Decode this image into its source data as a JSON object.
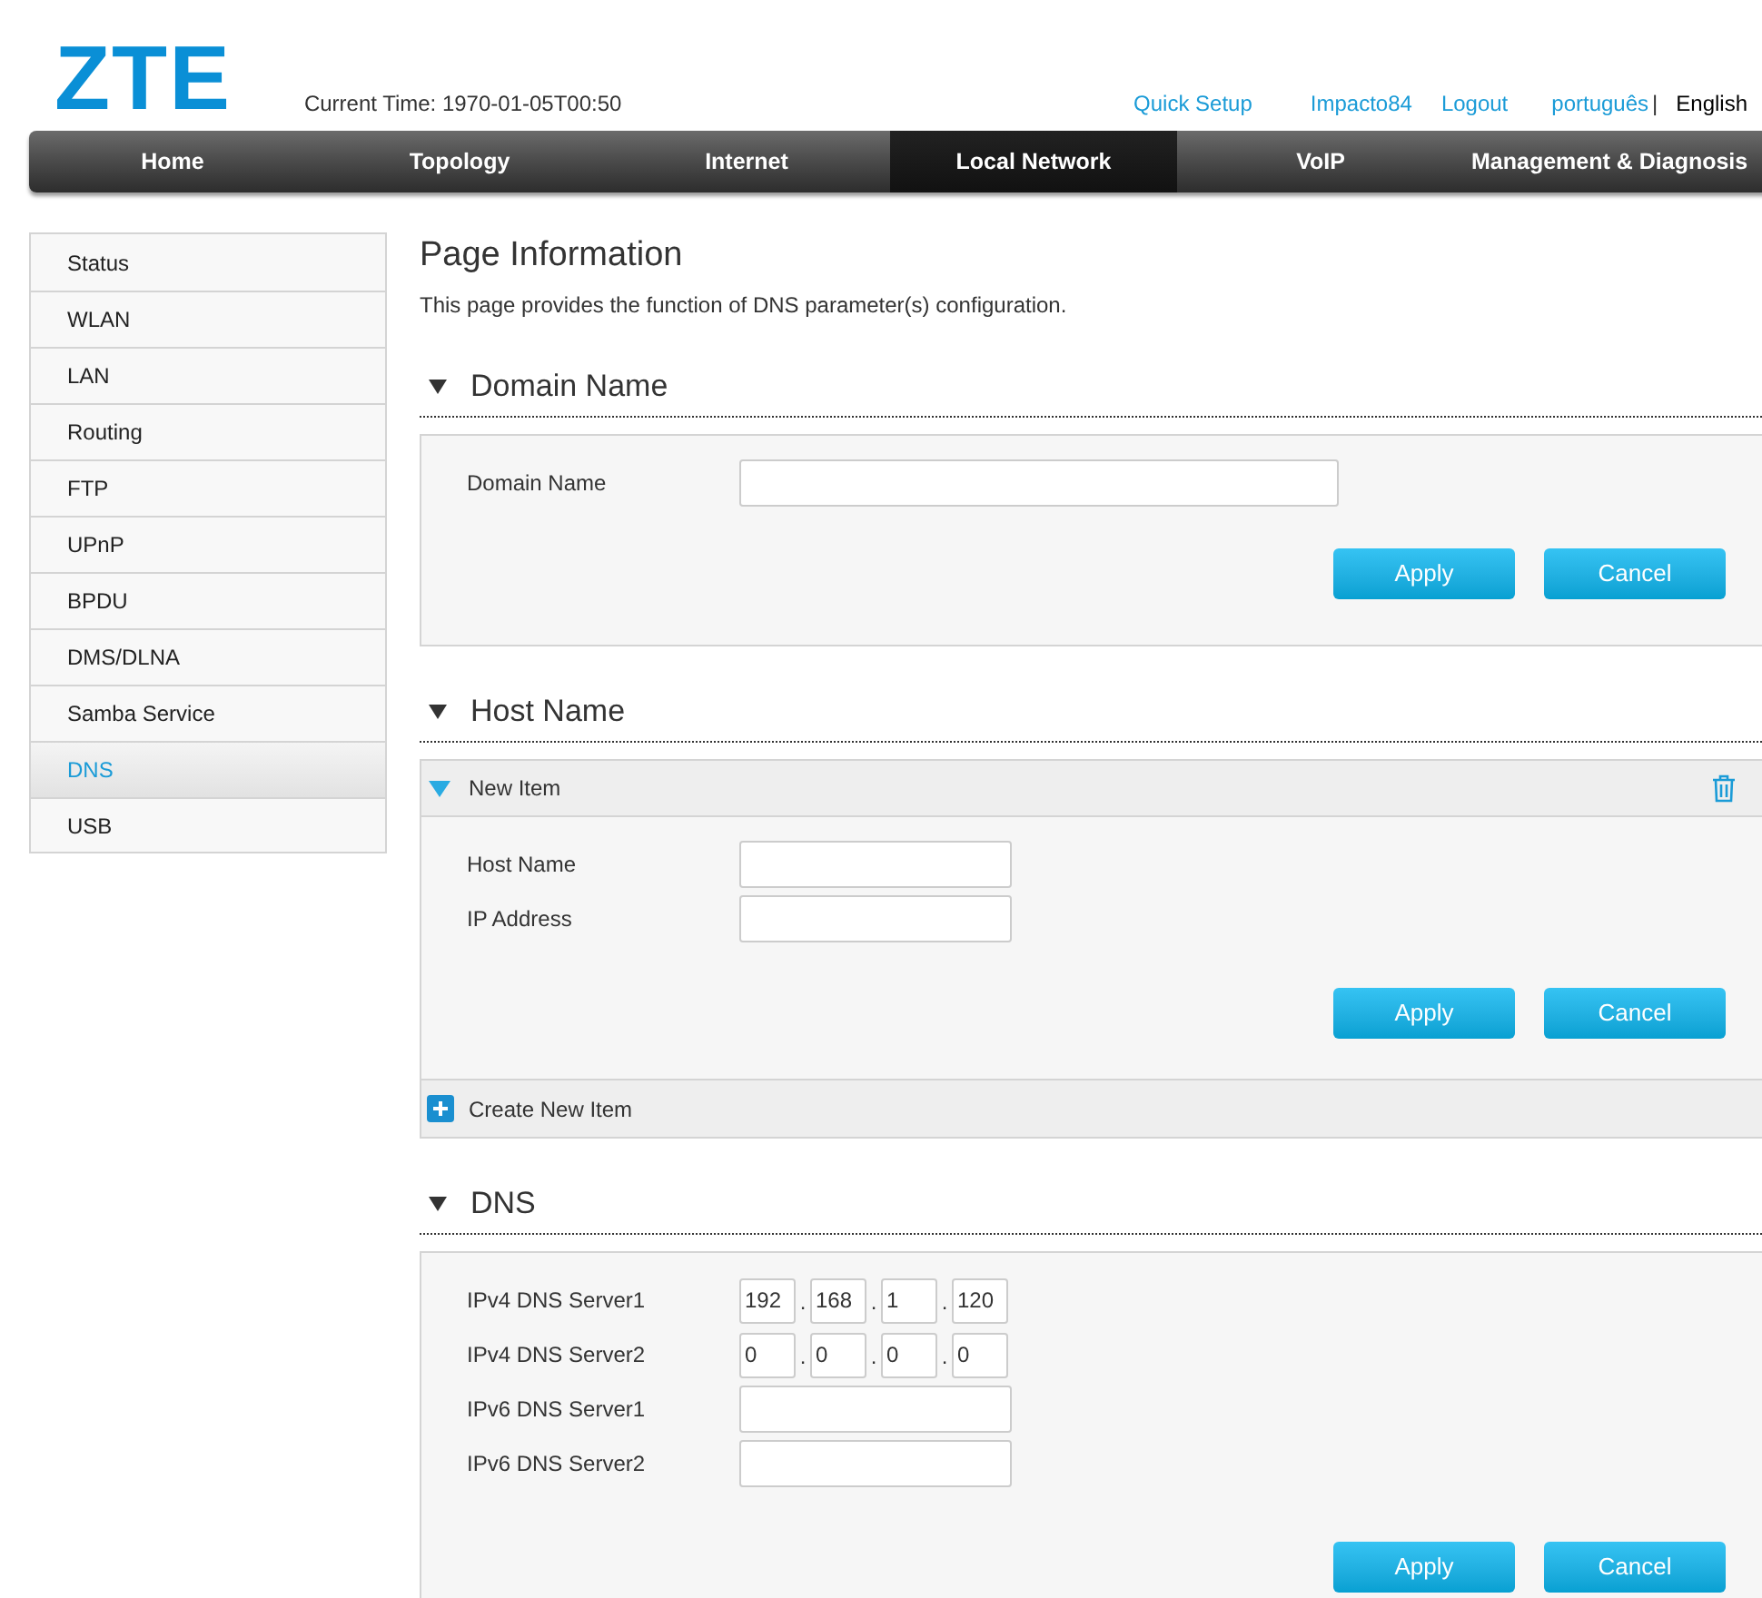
{
  "header": {
    "logo": "ZTE",
    "current_time": "Current Time: 1970-01-05T00:50",
    "links": [
      "Quick Setup",
      "Impacto84",
      "Logout"
    ],
    "languages": [
      {
        "label": "português",
        "selected": false
      },
      {
        "label": "English",
        "selected": true
      }
    ],
    "separator": "|"
  },
  "nav": [
    {
      "label": "Home",
      "selected": false
    },
    {
      "label": "Topology",
      "selected": false
    },
    {
      "label": "Internet",
      "selected": false
    },
    {
      "label": "Local Network",
      "selected": true
    },
    {
      "label": "VoIP",
      "selected": false
    },
    {
      "label": "Management & Diagnosis",
      "selected": false
    }
  ],
  "sidebar": [
    {
      "label": "Status",
      "selected": false
    },
    {
      "label": "WLAN",
      "selected": false
    },
    {
      "label": "LAN",
      "selected": false
    },
    {
      "label": "Routing",
      "selected": false
    },
    {
      "label": "FTP",
      "selected": false
    },
    {
      "label": "UPnP",
      "selected": false
    },
    {
      "label": "BPDU",
      "selected": false
    },
    {
      "label": "DMS/DLNA",
      "selected": false
    },
    {
      "label": "Samba Service",
      "selected": false
    },
    {
      "label": "DNS",
      "selected": true
    },
    {
      "label": "USB",
      "selected": false
    }
  ],
  "page": {
    "title": "Page Information",
    "description": "This page provides the function of DNS parameter(s) configuration."
  },
  "domain_section": {
    "heading": "Domain Name",
    "expanded": true,
    "fields": [
      {
        "kind": "wide",
        "label": "Domain Name"
      }
    ],
    "buttons": [
      "Apply",
      "Cancel"
    ]
  },
  "host_section": {
    "heading": "Host Name",
    "expanded": true,
    "item": {
      "title": "New Item",
      "expanded": true
    },
    "fields": [
      {
        "kind": "text",
        "label": "Host Name"
      },
      {
        "kind": "text",
        "label": "IP Address"
      }
    ],
    "buttons": [
      "Apply",
      "Cancel"
    ],
    "create_label": "Create New Item"
  },
  "dns_section": {
    "heading": "DNS",
    "expanded": true,
    "fields": [
      {
        "kind": "ipv4",
        "label": "IPv4 DNS Server1",
        "octets": [
          "192",
          "168",
          "1",
          "120"
        ],
        "dot": "."
      },
      {
        "kind": "ipv4",
        "label": "IPv4 DNS Server2",
        "octets": [
          "0",
          "0",
          "0",
          "0"
        ],
        "dot": "."
      },
      {
        "kind": "text",
        "label": "IPv6 DNS Server1"
      },
      {
        "kind": "text",
        "label": "IPv6 DNS Server2"
      }
    ],
    "buttons": [
      "Apply",
      "Cancel"
    ]
  }
}
